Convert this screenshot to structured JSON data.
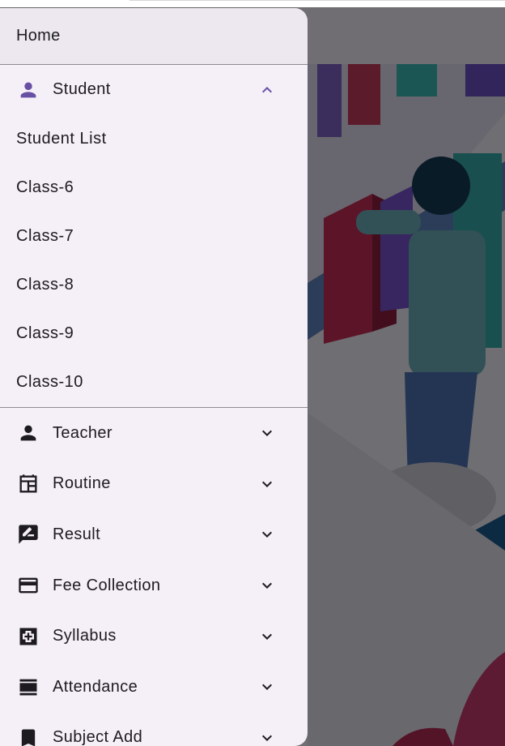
{
  "drawer": {
    "home_label": "Home",
    "expanded_group": {
      "label": "Student",
      "icon": "person-icon",
      "chevron": "chevron-up-icon",
      "items": [
        "Student List",
        "Class-6",
        "Class-7",
        "Class-8",
        "Class-9",
        "Class-10"
      ]
    },
    "groups": [
      {
        "label": "Teacher",
        "icon": "person-icon"
      },
      {
        "label": "Routine",
        "icon": "calendar-view-icon"
      },
      {
        "label": "Result",
        "icon": "rate-review-icon"
      },
      {
        "label": "Fee Collection",
        "icon": "credit-card-icon"
      },
      {
        "label": "Syllabus",
        "icon": "syllabus-icon"
      },
      {
        "label": "Attendance",
        "icon": "view-agenda-icon"
      },
      {
        "label": "Subject Add",
        "icon": "bookmark-icon"
      }
    ]
  },
  "colors": {
    "drawer_bg": "#f5eff8",
    "accent": "#6750a4",
    "text": "#1d1b20",
    "icon": "#49454f"
  }
}
